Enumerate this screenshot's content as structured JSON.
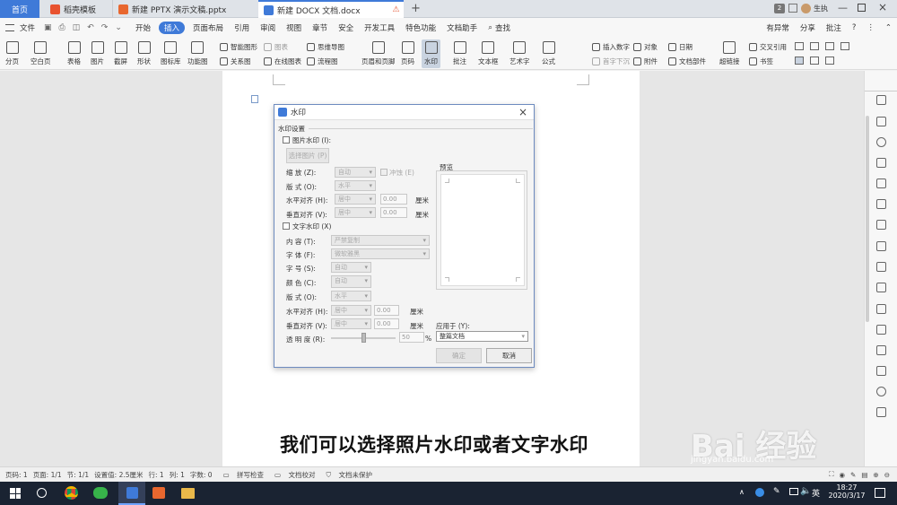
{
  "tabs": {
    "home": "首页",
    "daoke": "稻壳模板",
    "pptx": "新建 PPTX 演示文稿.pptx",
    "docx": "新建 DOCX 文档.docx",
    "count": "2",
    "user": "生执"
  },
  "menubar": {
    "file": "文件",
    "items": [
      "开始",
      "插入",
      "页面布局",
      "引用",
      "审阅",
      "视图",
      "章节",
      "安全",
      "开发工具",
      "特色功能",
      "文档助手"
    ],
    "active": "插入",
    "search": "查找",
    "changes": "有异常",
    "share": "分享",
    "comment": "批注"
  },
  "ribbon": {
    "large": [
      "分页",
      "空白页",
      "表格",
      "图片",
      "截屏",
      "形状",
      "图标库",
      "功能图",
      "页眉和页脚",
      "页码",
      "水印",
      "批注",
      "文本框",
      "艺术字",
      "公式",
      "超链接"
    ],
    "small": [
      "智能图形",
      "图表",
      "关系图",
      "在线图表",
      "思维导图",
      "流程图",
      "插入数字",
      "对象",
      "日期",
      "首字下沉",
      "附件",
      "文档部件",
      "交叉引用",
      "书签"
    ]
  },
  "dialog": {
    "title": "水印",
    "section": "水印设置",
    "picture_watermark": "图片水印 (I):",
    "select_picture": "选择图片 (P)",
    "scale_label": "缩    放 (Z):",
    "scale_value": "自动",
    "washout": "冲蚀 (E)",
    "layout_label": "版    式 (O):",
    "layout_value": "水平",
    "halign_label": "水平对齐 (H):",
    "halign_value": "居中",
    "halign_num": "0.00",
    "valign_label": "垂直对齐 (V):",
    "valign_value": "居中",
    "valign_num": "0.00",
    "unit": "厘米",
    "preview": "预览",
    "text_watermark": "文字水印 (X)",
    "content_label": "内    容 (T):",
    "content_value": "严禁复制",
    "font_label": "字    体 (F):",
    "font_value": "微软雅黑",
    "size_label": "字    号 (S):",
    "size_value": "自动",
    "color_label": "颜    色 (C):",
    "color_value": "自动",
    "tlayout_label": "版    式 (O):",
    "tlayout_value": "水平",
    "thalign_label": "水平对齐 (H):",
    "thalign_value": "居中",
    "thalign_num": "0.00",
    "tvalign_label": "垂直对齐 (V):",
    "tvalign_value": "居中",
    "tvalign_num": "0.00",
    "transparency_label": "透 明 度 (R):",
    "transparency_value": "50",
    "percent": "%",
    "apply_label": "应用于 (Y):",
    "apply_value": "整篇文档",
    "ok": "确定",
    "cancel": "取消"
  },
  "status": {
    "page_num": "页码: 1",
    "pages": "页面: 1/1",
    "section": "节: 1/1",
    "setting": "设置值: 2.5厘米",
    "row": "行: 1",
    "col": "列: 1",
    "words": "字数: 0",
    "spell": "拼写检查",
    "proof": "文档校对",
    "protect": "文档未保护"
  },
  "taskbar": {
    "time": "18:27",
    "date": "2020/3/17",
    "ime": "英"
  },
  "subtitle": "我们可以选择照片水印或者文字水印",
  "watermark": "Bai 经验",
  "watermark_url": "jingyan.baidu.com",
  "colors": {
    "accent": "#3f7ad8",
    "taskbar": "#1a2332",
    "dialog_border": "#6d8bbf"
  }
}
